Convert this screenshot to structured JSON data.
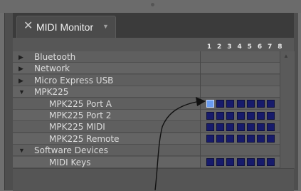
{
  "tab": {
    "title": "MIDI Monitor",
    "close_icon": "close-icon",
    "menu_icon": "chevron-down-icon"
  },
  "columns": [
    "1",
    "2",
    "3",
    "4",
    "5",
    "6",
    "7",
    "8"
  ],
  "rows": [
    {
      "label": "Bluetooth",
      "kind": "group",
      "expanded": false,
      "cells": null
    },
    {
      "label": "Network",
      "kind": "group",
      "expanded": false,
      "cells": null
    },
    {
      "label": "Micro Express USB",
      "kind": "group",
      "expanded": false,
      "cells": null
    },
    {
      "label": "MPK225",
      "kind": "group",
      "expanded": true,
      "cells": null
    },
    {
      "label": "MPK225 Port A",
      "kind": "port",
      "cells": [
        true,
        false,
        false,
        false,
        false,
        false,
        false
      ]
    },
    {
      "label": "MPK225 Port 2",
      "kind": "port",
      "cells": [
        false,
        false,
        false,
        false,
        false,
        false,
        false
      ]
    },
    {
      "label": "MPK225 MIDI",
      "kind": "port",
      "cells": [
        false,
        false,
        false,
        false,
        false,
        false,
        false
      ]
    },
    {
      "label": "MPK225 Remote",
      "kind": "port",
      "cells": [
        false,
        false,
        false,
        false,
        false,
        false,
        false
      ]
    },
    {
      "label": "Software Devices",
      "kind": "group",
      "expanded": true,
      "cells": null
    },
    {
      "label": "MIDI Keys",
      "kind": "port",
      "cells": [
        false,
        false,
        false,
        false,
        false,
        false,
        false
      ]
    }
  ],
  "colors": {
    "cell_off": "#171b6b",
    "cell_on": "#6a9cf0",
    "row_text": "#dcdcdc"
  }
}
